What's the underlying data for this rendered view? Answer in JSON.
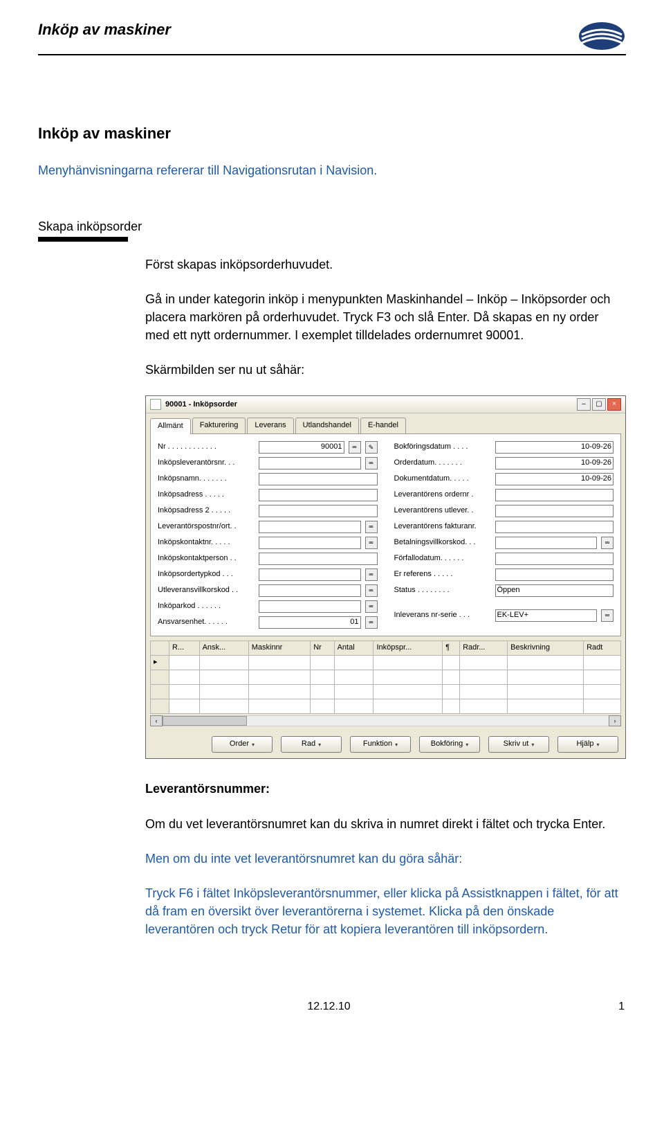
{
  "header": {
    "title": "Inköp av maskiner"
  },
  "section_title": "Inköp av maskiner",
  "subtitle": "Menyhänvisningarna refererar till Navigationsrutan i Navision.",
  "block_label": "Skapa inköpsorder",
  "para1": "Först skapas inköpsorderhuvudet.",
  "para2": "Gå in under kategorin inköp i menypunkten Maskinhandel – Inköp – Inköpsorder och placera markören på orderhuvudet. Tryck F3 och slå Enter. Då skapas en ny order med ett nytt ordernummer. I exemplet  tilldelades ordernumret 90001.",
  "para3": "Skärmbilden ser nu ut såhär:",
  "window": {
    "title": "90001 - Inköpsorder",
    "tabs": [
      "Allmänt",
      "Fakturering",
      "Leverans",
      "Utlandshandel",
      "E-handel"
    ],
    "left_fields": [
      {
        "label": "Nr . . . . . . . . . . . .",
        "value": "90001",
        "lookup": true,
        "edit": true
      },
      {
        "label": "Inköpsleverantörsnr. . .",
        "value": "",
        "lookup": true
      },
      {
        "label": "Inköpsnamn. . . . . . .",
        "value": ""
      },
      {
        "label": "Inköpsadress . . . . .",
        "value": ""
      },
      {
        "label": "Inköpsadress 2 . . . . .",
        "value": ""
      },
      {
        "label": "Leverantörspostnr/ort. .",
        "value": "",
        "lookup": true
      },
      {
        "label": "Inköpskontaktnr. . . . .",
        "value": "",
        "lookup": true
      },
      {
        "label": "Inköpskontaktperson . .",
        "value": ""
      },
      {
        "label": "Inköpsordertypkod . . .",
        "value": "",
        "lookup": true
      },
      {
        "label": "Utleveransvillkorskod . .",
        "value": "",
        "lookup": true
      },
      {
        "label": "Inköparkod . . . . . .",
        "value": "",
        "lookup": true
      },
      {
        "label": "Ansvarsenhet. . . . . .",
        "value": "01",
        "lookup": true
      }
    ],
    "right_fields": [
      {
        "label": "Bokföringsdatum . . . .",
        "value": "10-09-26"
      },
      {
        "label": "Orderdatum. . . . . . .",
        "value": "10-09-26"
      },
      {
        "label": "Dokumentdatum. . . . .",
        "value": "10-09-26"
      },
      {
        "label": "Leverantörens ordernr .",
        "value": ""
      },
      {
        "label": "Leverantörens utlever. .",
        "value": ""
      },
      {
        "label": "Leverantörens fakturanr.",
        "value": ""
      },
      {
        "label": "Betalningsvillkorskod. . .",
        "value": "",
        "lookup": true
      },
      {
        "label": "Förfallodatum. . . . . .",
        "value": ""
      },
      {
        "label": "Er referens . . . . .",
        "value": ""
      },
      {
        "label": "Status . . . . . . . .",
        "value": "Öppen"
      }
    ],
    "extra_row": {
      "label": "Inleverans nr-serie   . . .",
      "value": "EK-LEV+",
      "lookup": true
    },
    "grid_headers": [
      "",
      "R...",
      "Ansk...",
      "Maskinnr",
      "Nr",
      "Antal",
      "Inköpspr...",
      "¶",
      "Radr...",
      "Beskrivning",
      "Radt"
    ],
    "buttons": [
      "Order",
      "Rad",
      "Funktion",
      "Bokföring",
      "Skriv ut",
      "Hjälp"
    ]
  },
  "lev_heading": "Leverantörsnummer:",
  "lev_p1": "Om du vet leverantörsnumret kan du skriva in numret direkt i fältet och trycka Enter.",
  "lev_p2": "Men om du inte vet leverantörsnumret kan du göra såhär:",
  "lev_p3": "Tryck F6 i fältet Inköpsleverantörsnummer, eller klicka på Assistknappen i fältet, för att då fram en översikt över leverantörerna i systemet. Klicka på den önskade leverantören och tryck Retur för att kopiera leverantören till inköpsordern.",
  "footer": {
    "date": "12.12.10",
    "page": "1"
  }
}
